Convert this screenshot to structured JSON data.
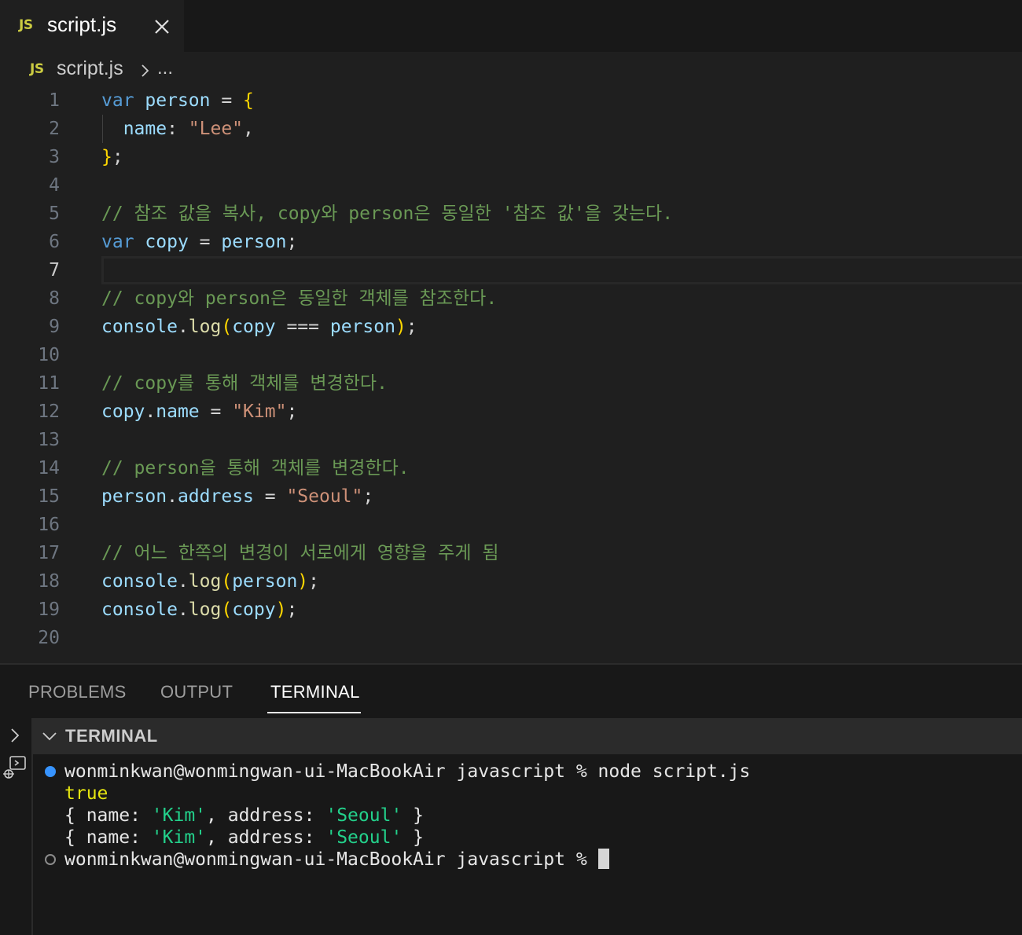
{
  "tab": {
    "badge": "JS",
    "title": "script.js",
    "close_icon": "close-icon"
  },
  "breadcrumb": {
    "badge": "JS",
    "file": "script.js",
    "more": "..."
  },
  "editor": {
    "active_line": 7,
    "lines": [
      {
        "n": "1",
        "tokens": [
          [
            "kw",
            "var"
          ],
          [
            "op",
            " "
          ],
          [
            "var",
            "person"
          ],
          [
            "op",
            " = "
          ],
          [
            "br1",
            "{"
          ]
        ]
      },
      {
        "n": "2",
        "tokens": [
          [
            "op",
            "  "
          ],
          [
            "var",
            "name"
          ],
          [
            "op",
            ": "
          ],
          [
            "str",
            "\"Lee\""
          ],
          [
            "op",
            ","
          ]
        ]
      },
      {
        "n": "3",
        "tokens": [
          [
            "br1",
            "}"
          ],
          [
            "op",
            ";"
          ]
        ]
      },
      {
        "n": "4",
        "tokens": []
      },
      {
        "n": "5",
        "tokens": [
          [
            "cm",
            "// 참조 값을 복사, copy와 person은 동일한 '참조 값'을 갖는다."
          ]
        ]
      },
      {
        "n": "6",
        "tokens": [
          [
            "kw",
            "var"
          ],
          [
            "op",
            " "
          ],
          [
            "var",
            "copy"
          ],
          [
            "op",
            " = "
          ],
          [
            "var",
            "person"
          ],
          [
            "op",
            ";"
          ]
        ]
      },
      {
        "n": "7",
        "tokens": []
      },
      {
        "n": "8",
        "tokens": [
          [
            "cm",
            "// copy와 person은 동일한 객체를 참조한다."
          ]
        ]
      },
      {
        "n": "9",
        "tokens": [
          [
            "var",
            "console"
          ],
          [
            "op",
            "."
          ],
          [
            "fn",
            "log"
          ],
          [
            "br1",
            "("
          ],
          [
            "var",
            "copy"
          ],
          [
            "op",
            " === "
          ],
          [
            "var",
            "person"
          ],
          [
            "br1",
            ")"
          ],
          [
            "op",
            ";"
          ]
        ]
      },
      {
        "n": "10",
        "tokens": []
      },
      {
        "n": "11",
        "tokens": [
          [
            "cm",
            "// copy를 통해 객체를 변경한다."
          ]
        ]
      },
      {
        "n": "12",
        "tokens": [
          [
            "var",
            "copy"
          ],
          [
            "op",
            "."
          ],
          [
            "var",
            "name"
          ],
          [
            "op",
            " = "
          ],
          [
            "str",
            "\"Kim\""
          ],
          [
            "op",
            ";"
          ]
        ]
      },
      {
        "n": "13",
        "tokens": []
      },
      {
        "n": "14",
        "tokens": [
          [
            "cm",
            "// person을 통해 객체를 변경한다."
          ]
        ]
      },
      {
        "n": "15",
        "tokens": [
          [
            "var",
            "person"
          ],
          [
            "op",
            "."
          ],
          [
            "var",
            "address"
          ],
          [
            "op",
            " = "
          ],
          [
            "str",
            "\"Seoul\""
          ],
          [
            "op",
            ";"
          ]
        ]
      },
      {
        "n": "16",
        "tokens": []
      },
      {
        "n": "17",
        "tokens": [
          [
            "cm",
            "// 어느 한쪽의 변경이 서로에게 영향을 주게 됨"
          ]
        ]
      },
      {
        "n": "18",
        "tokens": [
          [
            "var",
            "console"
          ],
          [
            "op",
            "."
          ],
          [
            "fn",
            "log"
          ],
          [
            "br1",
            "("
          ],
          [
            "var",
            "person"
          ],
          [
            "br1",
            ")"
          ],
          [
            "op",
            ";"
          ]
        ]
      },
      {
        "n": "19",
        "tokens": [
          [
            "var",
            "console"
          ],
          [
            "op",
            "."
          ],
          [
            "fn",
            "log"
          ],
          [
            "br1",
            "("
          ],
          [
            "var",
            "copy"
          ],
          [
            "br1",
            ")"
          ],
          [
            "op",
            ";"
          ]
        ]
      },
      {
        "n": "20",
        "tokens": []
      }
    ]
  },
  "panel": {
    "tabs": [
      "PROBLEMS",
      "OUTPUT",
      "TERMINAL"
    ],
    "active_tab": "TERMINAL",
    "section_title": "TERMINAL"
  },
  "terminal": {
    "line1": "wonminkwan@wonmingwan-ui-MacBookAir javascript % node script.js",
    "line2": "true",
    "line3": [
      [
        "d",
        "{ name: "
      ],
      [
        "g",
        "'Kim'"
      ],
      [
        "d",
        ", address: "
      ],
      [
        "g",
        "'Seoul'"
      ],
      [
        "d",
        " }"
      ]
    ],
    "line4": [
      [
        "d",
        "{ name: "
      ],
      [
        "g",
        "'Kim'"
      ],
      [
        "d",
        ", address: "
      ],
      [
        "g",
        "'Seoul'"
      ],
      [
        "d",
        " }"
      ]
    ],
    "line5": "wonminkwan@wonmingwan-ui-MacBookAir javascript % "
  },
  "colors": {
    "accent_blue": "#3794ff",
    "js_badge": "#cbcb41"
  }
}
